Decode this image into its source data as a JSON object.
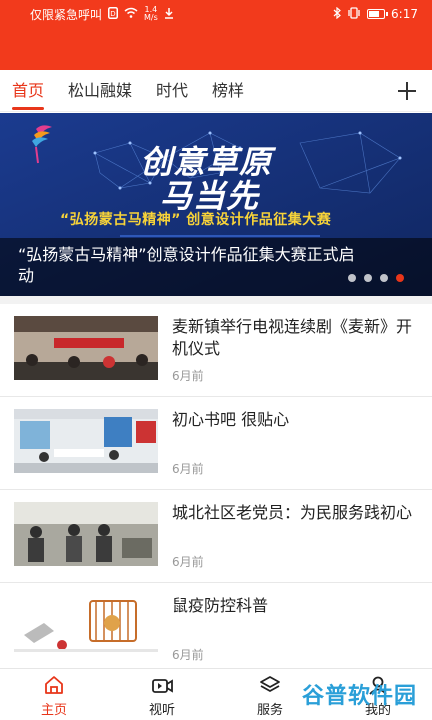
{
  "status_bar": {
    "left_text": "仅限紧急呼叫",
    "network_speed": "1.4",
    "network_unit": "M/s",
    "time": "6:17"
  },
  "tabs": [
    {
      "label": "首页",
      "active": true
    },
    {
      "label": "松山融媒",
      "active": false
    },
    {
      "label": "时代",
      "active": false
    },
    {
      "label": "榜样",
      "active": false
    }
  ],
  "banner": {
    "headline_line1": "创意草原",
    "headline_line2": "马当先",
    "inner_title": "“弘扬蒙古马精神” 创意设计作品征集大赛",
    "caption": "“弘扬蒙古马精神”创意设计作品征集大赛正式启动",
    "slide_count": 4,
    "active_slide": 4
  },
  "news": [
    {
      "title": "麦新镇举行电视连续剧《麦新》开机仪式",
      "time": "6月前",
      "thumb": "ceremony-photo"
    },
    {
      "title": "初心书吧 很贴心",
      "time": "6月前",
      "thumb": "reading-room-photo"
    },
    {
      "title": "城北社区老党员：为民服务践初心",
      "time": "6月前",
      "thumb": "community-volunteers-photo"
    },
    {
      "title": "鼠疫防控科普",
      "time": "6月前",
      "thumb": "plague-prevention-illustration"
    }
  ],
  "bottom_nav": [
    {
      "label": "主页",
      "icon": "home-icon",
      "active": true
    },
    {
      "label": "视听",
      "icon": "video-icon",
      "active": false
    },
    {
      "label": "服务",
      "icon": "layers-icon",
      "active": false
    },
    {
      "label": "我的",
      "icon": "user-icon",
      "active": false
    }
  ],
  "watermark": {
    "text": "谷普软件园"
  },
  "colors": {
    "accent": "#e8361a",
    "header": "#f23a1c",
    "banner_bg": "#15327c"
  }
}
